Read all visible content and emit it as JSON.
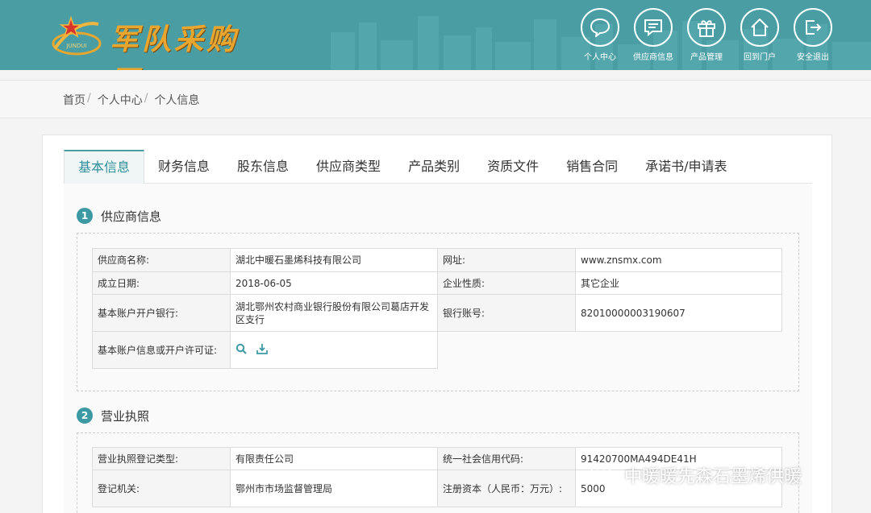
{
  "header": {
    "logo_emblem_text": "JUNDUI",
    "logo_text": "军队采购网",
    "nav": [
      {
        "label": "个人中心",
        "icon": "chat-bubble-icon"
      },
      {
        "label": "供应商信息",
        "icon": "message-lines-icon"
      },
      {
        "label": "产品管理",
        "icon": "gift-icon"
      },
      {
        "label": "回到门户",
        "icon": "home-icon"
      },
      {
        "label": "安全退出",
        "icon": "logout-icon"
      }
    ]
  },
  "breadcrumb": [
    "首页",
    "个人中心",
    "个人信息"
  ],
  "tabs": [
    {
      "label": "基本信息",
      "active": true
    },
    {
      "label": "财务信息"
    },
    {
      "label": "股东信息"
    },
    {
      "label": "供应商类型"
    },
    {
      "label": "产品类别"
    },
    {
      "label": "资质文件"
    },
    {
      "label": "销售合同"
    },
    {
      "label": "承诺书/申请表"
    }
  ],
  "section1": {
    "number": "1",
    "title": "供应商信息",
    "rows": [
      {
        "l1": "供应商名称:",
        "v1": "湖北中暖石墨烯科技有限公司",
        "l2": "网址:",
        "v2": "www.znsmx.com"
      },
      {
        "l1": "成立日期:",
        "v1": "2018-06-05",
        "l2": "企业性质:",
        "v2": "其它企业"
      },
      {
        "l1": "基本账户开户银行:",
        "v1": "湖北鄂州农村商业银行股份有限公司葛店开发区支行",
        "l2": "银行账号:",
        "v2": "82010000003190607"
      },
      {
        "l1": "基本账户信息或开户许可证:"
      }
    ]
  },
  "section2": {
    "number": "2",
    "title": "营业执照",
    "rows": [
      {
        "l1": "营业执照登记类型:",
        "v1": "有限责任公司",
        "l2": "统一社会信用代码:",
        "v2": "91420700MA494DE41H"
      },
      {
        "l1": "登记机关:",
        "v1": "鄂州市市场监督管理局",
        "l2": "注册资本（人民币：万元）:",
        "v2": "5000"
      }
    ]
  },
  "watermark": {
    "text": "中暖暖先森石墨烯供暖"
  },
  "colors": {
    "header": "#4a9ea3",
    "accent": "#3d9aa4",
    "logo_gold": "#e9a62f"
  }
}
